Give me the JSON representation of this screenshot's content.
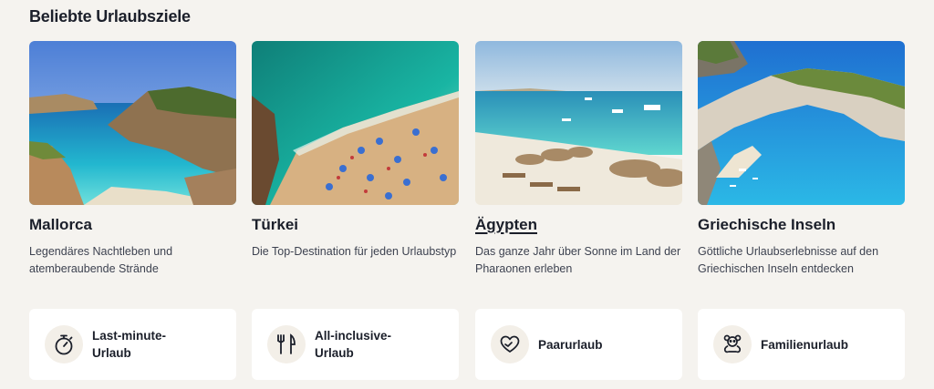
{
  "section": {
    "title": "Beliebte Urlaubsziele"
  },
  "destinations": [
    {
      "name": "Mallorca",
      "description": "Legendäres Nachtleben und atemberaubende Strände"
    },
    {
      "name": "Türkei",
      "description": "Die Top-Destination für jeden Urlaubstyp"
    },
    {
      "name": "Ägypten",
      "description": "Das ganze Jahr über Sonne im Land der Pharaonen erleben"
    },
    {
      "name": "Griechische Inseln",
      "description": "Göttliche Urlaubserlebnisse auf den Griechischen Inseln entdecken"
    }
  ],
  "themes": [
    {
      "label": "Last-minute-Urlaub",
      "icon": "stopwatch-icon"
    },
    {
      "label": "All-inclusive-Urlaub",
      "icon": "cutlery-icon"
    },
    {
      "label": "Paarurlaub",
      "icon": "heart-hands-icon"
    },
    {
      "label": "Familienurlaub",
      "icon": "teddy-bear-icon"
    }
  ],
  "colors": {
    "background": "#f5f3ef",
    "card": "#ffffff",
    "text": "#1b1f2a",
    "icon_bg": "#f3efe8"
  }
}
